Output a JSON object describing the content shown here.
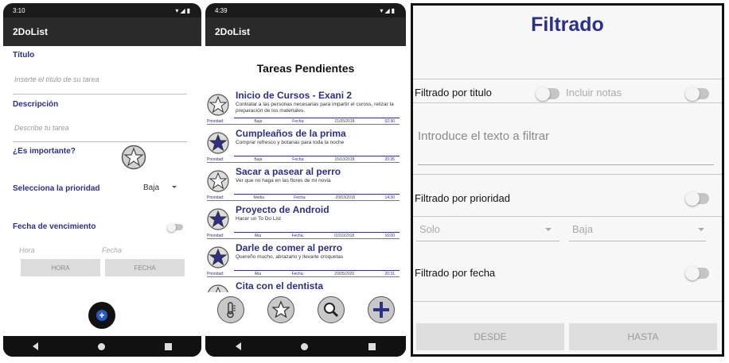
{
  "colors": {
    "accent": "#2c2f8c",
    "appbar": "#2a2a2a",
    "fab": "#2a59c8"
  },
  "phone1": {
    "status_time": "3:10",
    "app_title": "2DoList",
    "titulo_label": "Título",
    "titulo_placeholder": "Inserte el título de su tarea",
    "descripcion_label": "Descripción",
    "descripcion_placeholder": "Describe tu tarea",
    "importante_label": "¿Es importante?",
    "prioridad_label": "Selecciona la prioridad",
    "prioridad_value": "Baja",
    "fecha_label": "Fecha de vencimiento",
    "hora_hint": "Hora",
    "fecha_hint": "Fecha",
    "hora_button": "HORA",
    "fecha_button": "FECHA",
    "fab_icon": "add-icon"
  },
  "phone2": {
    "status_time": "4:39",
    "app_title": "2DoList",
    "list_title": "Tareas Pendientes",
    "meta_labels": {
      "prioridad": "Prioridad:",
      "fecha": "Fecha:"
    },
    "tasks": [
      {
        "title": "Inicio de Cursos - Exani 2",
        "desc": "Contratar a las personas necesarias para impartir el cuross, relizar la preparación de los materiales.",
        "priority": "Baja",
        "date": "21/05/2018",
        "time": "02:30",
        "important": false
      },
      {
        "title": "Cumpleaños de la prima",
        "desc": "Comprar refresco y botanas para toda la noche",
        "priority": "Baja",
        "date": "15/10/2018",
        "time": "20:35",
        "important": true
      },
      {
        "title": "Sacar a pasear al perro",
        "desc": "Ver que no haga en las flores de mi novia",
        "priority": "Media",
        "date": "20/03/2015",
        "time": "14:30",
        "important": false
      },
      {
        "title": "Proyecto de Android",
        "desc": "Hacer un To Do List",
        "priority": "Alta",
        "date": "02/10/2018",
        "time": "16:00",
        "important": true
      },
      {
        "title": "Darle de comer al perro",
        "desc": "Quereño mucho, abrazarlo y llevarle croquetas",
        "priority": "Alta",
        "date": "20/05/2020",
        "time": "20:31",
        "important": true
      },
      {
        "title": "Cita con el dentista",
        "desc": "",
        "priority": "",
        "date": "",
        "time": "",
        "important": false
      }
    ],
    "bottom_icons": [
      "thermometer-icon",
      "star-icon",
      "search-icon",
      "add-icon"
    ]
  },
  "panel": {
    "title": "Filtrado",
    "filtro_titulo_label": "Filtrado por titulo",
    "incluir_notas_label": "Incluir notas",
    "texto_placeholder": "Introduce el texto a filtrar",
    "filtro_prioridad_label": "Filtrado por prioridad",
    "solo_value": "Solo",
    "baja_value": "Baja",
    "filtro_fecha_label": "Filtrado por fecha",
    "desde_button": "DESDE",
    "hasta_button": "HASTA"
  }
}
